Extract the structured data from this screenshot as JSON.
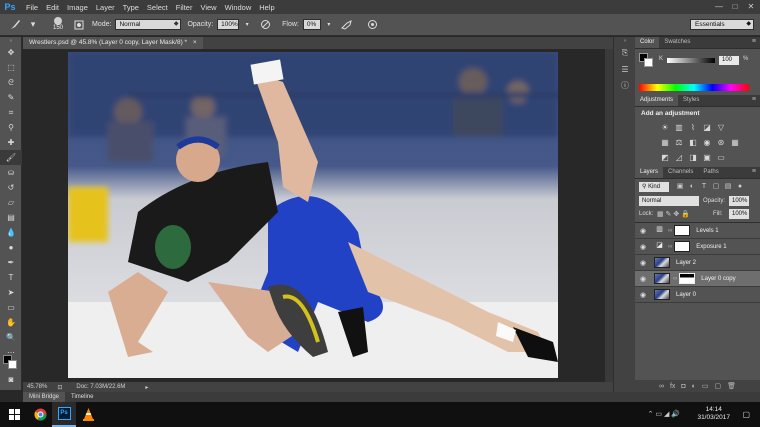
{
  "app": {
    "logo": "Ps"
  },
  "menu": [
    "File",
    "Edit",
    "Image",
    "Layer",
    "Type",
    "Select",
    "Filter",
    "View",
    "Window",
    "Help"
  ],
  "window_controls": {
    "minimize": "—",
    "maximize": "□",
    "close": "✕"
  },
  "options": {
    "brush_size": "150",
    "mode_label": "Mode:",
    "mode_value": "Normal",
    "opacity_label": "Opacity:",
    "opacity_value": "100%",
    "flow_label": "Flow:",
    "flow_value": "0%",
    "workspace": "Essentials"
  },
  "document": {
    "tab_title": "Wrestlers.psd @ 45.8% (Layer 0 copy, Layer Mask/8) *",
    "tab_close": "×",
    "zoom": "45.78%",
    "doc_size": "Doc: 7.03M/22.6M"
  },
  "color_panel": {
    "tabs": [
      "Color",
      "Swatches"
    ],
    "channel": "K",
    "value": "100",
    "unit": "%"
  },
  "adjustments_panel": {
    "tabs": [
      "Adjustments",
      "Styles"
    ],
    "title": "Add an adjustment"
  },
  "layers_panel": {
    "tabs": [
      "Layers",
      "Channels",
      "Paths"
    ],
    "kind": "Kind",
    "blend_mode": "Normal",
    "opacity_label": "Opacity:",
    "opacity_value": "100%",
    "lock_label": "Lock:",
    "fill_label": "Fill:",
    "fill_value": "100%",
    "layers": [
      {
        "name": "Levels 1",
        "type": "adjustment",
        "selected": false
      },
      {
        "name": "Exposure 1",
        "type": "adjustment",
        "selected": false
      },
      {
        "name": "Layer 2",
        "type": "photo",
        "selected": false
      },
      {
        "name": "Layer 0 copy",
        "type": "masked",
        "selected": true
      },
      {
        "name": "Layer 0",
        "type": "photo",
        "selected": false
      }
    ]
  },
  "bottom_tabs": [
    "Mini Bridge",
    "Timeline"
  ],
  "taskbar": {
    "time": "14:14",
    "date": "31/03/2017"
  }
}
